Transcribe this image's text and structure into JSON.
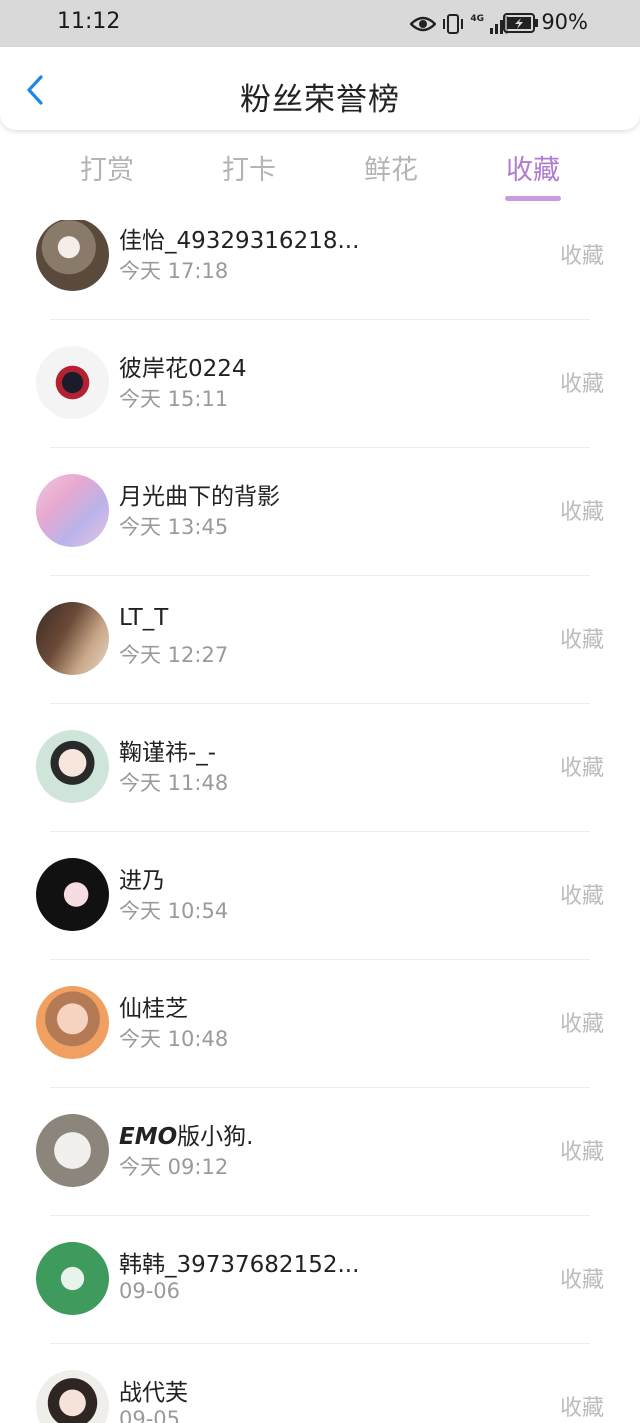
{
  "status_bar": {
    "time": "11:12",
    "network": "4G",
    "battery_pct": "90%",
    "icons": [
      "eye-icon",
      "vibrate-icon",
      "signal-icon",
      "battery-icon"
    ]
  },
  "header": {
    "title": "粉丝荣誉榜",
    "back_icon": "chevron-left-icon"
  },
  "tabs": [
    {
      "label": "打赏",
      "active": false
    },
    {
      "label": "打卡",
      "active": false
    },
    {
      "label": "鲜花",
      "active": false
    },
    {
      "label": "收藏",
      "active": true
    }
  ],
  "colors": {
    "accent": "#b07ccf",
    "underline": "#c89ae0",
    "back": "#1e88e5"
  },
  "rows": [
    {
      "name": "佳怡_49329316218...",
      "time": "今天 17:18",
      "action": "收藏"
    },
    {
      "name": "彼岸花0224",
      "time": "今天 15:11",
      "action": "收藏"
    },
    {
      "name": "月光曲下的背影",
      "time": "今天 13:45",
      "action": "收藏"
    },
    {
      "name": "LT_T",
      "time": "今天 12:27",
      "action": "收藏"
    },
    {
      "name": "鞠谨祎-_-",
      "time": "今天 11:48",
      "action": "收藏"
    },
    {
      "name": "进乃",
      "time": "今天 10:54",
      "action": "收藏"
    },
    {
      "name": "仙桂芝",
      "time": "今天 10:48",
      "action": "收藏"
    },
    {
      "name_bold_part": "EMO",
      "name": "版小狗.",
      "time": "今天 09:12",
      "action": "收藏"
    },
    {
      "name": "韩韩_39737682152...",
      "time": "09-06",
      "action": "收藏"
    },
    {
      "name": "战代芙",
      "time": "09-05",
      "action": "收藏"
    }
  ]
}
